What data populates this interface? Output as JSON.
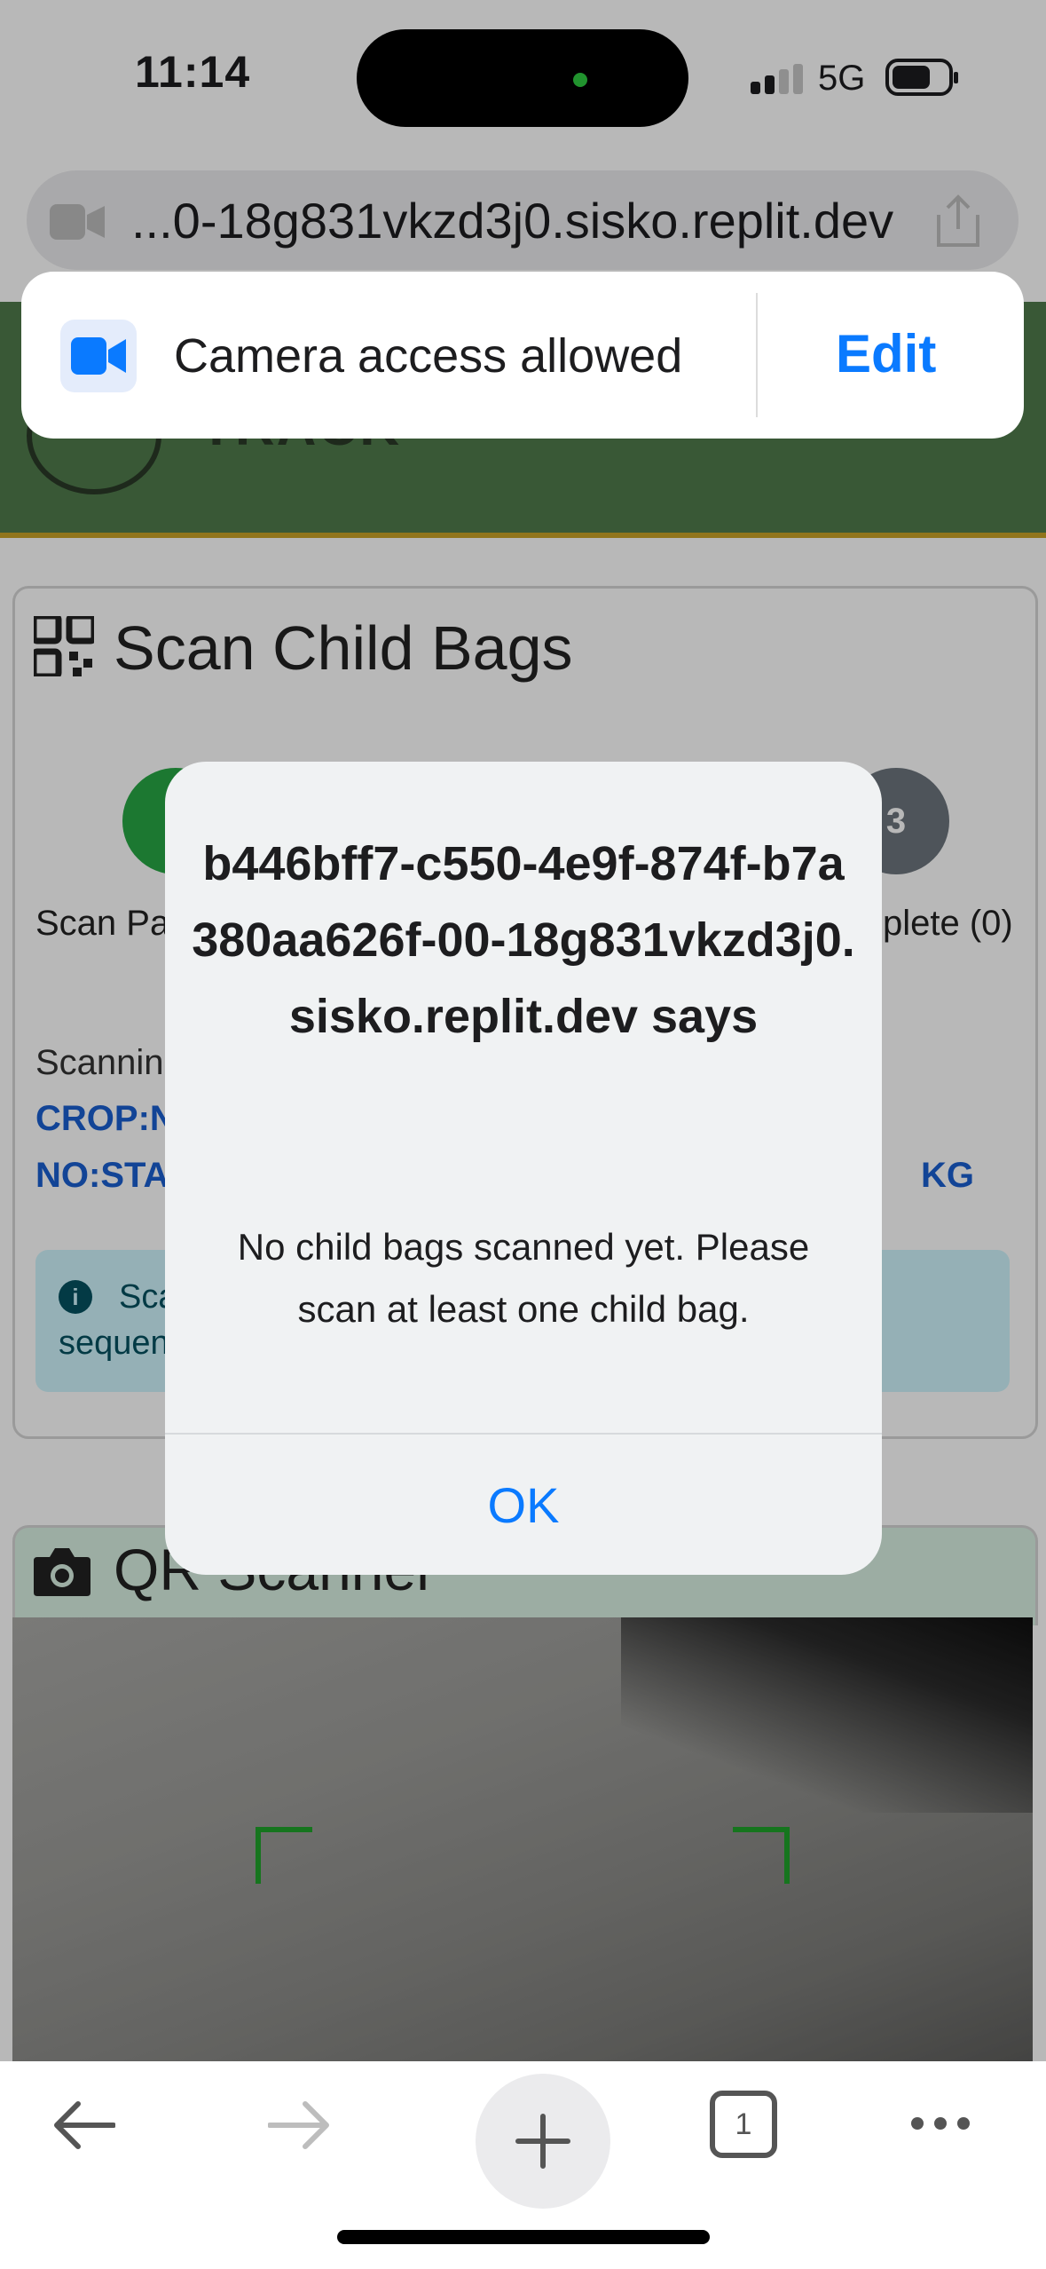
{
  "status_bar": {
    "time": "11:14",
    "network": "5G",
    "signal_icon": "cellular-signal-icon",
    "battery_icon": "battery-icon"
  },
  "browser": {
    "url": "...0-18g831vkzd3j0.sisko.replit.dev",
    "camera_icon": "video-camera-icon",
    "share_icon": "share-icon"
  },
  "camera_prompt": {
    "text": "Camera access allowed",
    "edit_label": "Edit"
  },
  "page": {
    "header_text": "TRACK",
    "card_title": "Scan Child Bags",
    "step1_label": "Scan Pa",
    "step3_number": "3",
    "step3_label": "plete (0)",
    "scanning_label": "Scannin",
    "crop_label": "CROP:N",
    "no_label": "NO:STA",
    "kg_label": "KG",
    "alert_line1": "Sca",
    "alert_line2": "sequen",
    "qr_title": "QR Scanner"
  },
  "dialog": {
    "title": "b446bff7-c550-4e9f-874f-b7a380aa626f-00-18g831vkzd3j0.sisko.replit.dev says",
    "message": "No child bags scanned yet. Please scan at least one child bag.",
    "ok_label": "OK"
  },
  "toolbar": {
    "back_icon": "back-arrow-icon",
    "forward_icon": "forward-arrow-icon",
    "new_tab_icon": "plus-icon",
    "tab_count": "1",
    "more_icon": "more-icon"
  },
  "colors": {
    "header_green": "#4f7a4c",
    "accent_blue": "#0a7aff",
    "scan_corner_green": "#1fa32a"
  }
}
